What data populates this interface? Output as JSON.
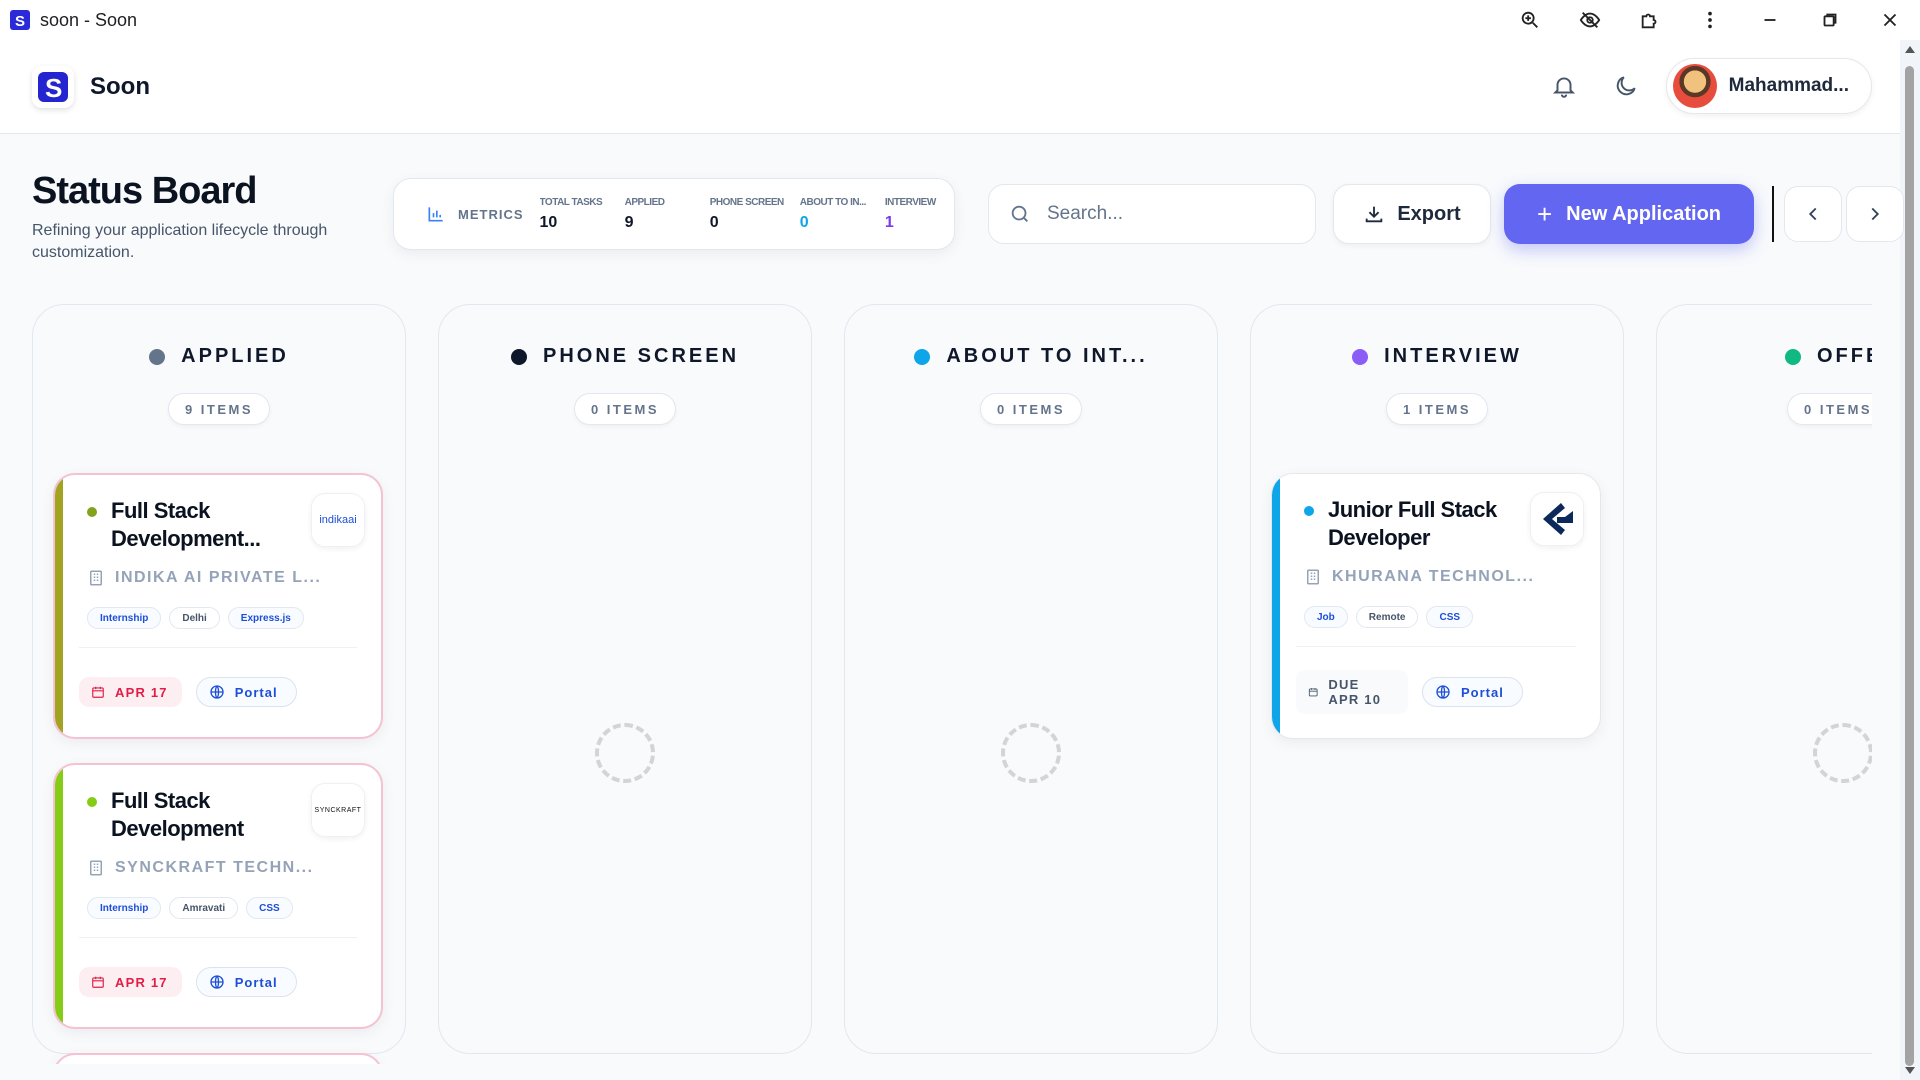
{
  "window": {
    "title": "soon - Soon"
  },
  "header": {
    "brand": "Soon",
    "user_name": "Mahammad..."
  },
  "page": {
    "title": "Status Board",
    "subtitle": "Refining your application lifecycle through customization."
  },
  "metrics": {
    "label": "METRICS",
    "items": [
      {
        "key": "TOTAL TASKS",
        "value": "10",
        "color": "#0f172a"
      },
      {
        "key": "APPLIED",
        "value": "9",
        "color": "#0f172a"
      },
      {
        "key": "PHONE SCREEN",
        "value": "0",
        "color": "#0f172a"
      },
      {
        "key": "ABOUT TO IN...",
        "value": "0",
        "color": "#0ea5e9"
      },
      {
        "key": "INTERVIEW",
        "value": "1",
        "color": "#7c3aed"
      }
    ]
  },
  "search": {
    "placeholder": "Search..."
  },
  "actions": {
    "export_label": "Export",
    "new_label": "New Application"
  },
  "columns": [
    {
      "title": "APPLIED",
      "count": "9 ITEMS",
      "dot": "#64748b"
    },
    {
      "title": "PHONE SCREEN",
      "count": "0 ITEMS",
      "dot": "#0f172a"
    },
    {
      "title": "ABOUT TO INT...",
      "count": "0 ITEMS",
      "dot": "#0ea5e9"
    },
    {
      "title": "INTERVIEW",
      "count": "1 ITEMS",
      "dot": "#8b5cf6"
    },
    {
      "title": "OFFE",
      "count": "0 ITEMS",
      "dot": "#10b981"
    }
  ],
  "cards": [
    {
      "title": "Full Stack Development...",
      "company": "INDIKA AI PRIVATE L...",
      "logo_text": "indikaai",
      "tags": [
        "Internship",
        "Delhi",
        "Express.js"
      ],
      "date": "APR 17",
      "portal": "Portal",
      "accent": "#a3a322",
      "dot": "#84a31d"
    },
    {
      "title": "Full Stack Development",
      "company": "SYNCKRAFT TECHN...",
      "logo_text": "SYNCKRAFT",
      "tags": [
        "Internship",
        "Amravati",
        "CSS"
      ],
      "date": "APR 17",
      "portal": "Portal",
      "accent": "#84cc16",
      "dot": "#84cc16"
    },
    {
      "title": "Junior Full Stack Developer",
      "company": "KHURANA TECHNOL...",
      "tags": [
        "Job",
        "Remote",
        "CSS"
      ],
      "date": "DUE APR 10",
      "portal": "Portal",
      "accent": "#0ea5e9",
      "dot": "#0ea5e9"
    }
  ],
  "icons": {
    "bell": "bell-icon",
    "theme": "moon-icon",
    "search": "search-icon",
    "export": "download-icon",
    "prev": "chevron-left-icon",
    "next": "chevron-right-icon"
  }
}
